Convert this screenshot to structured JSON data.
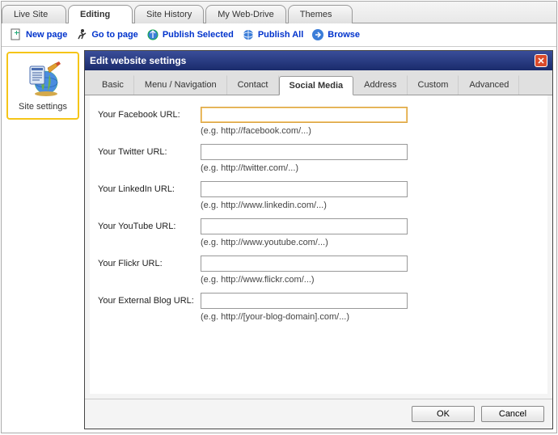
{
  "top_tabs": [
    "Live Site",
    "Editing",
    "Site History",
    "My Web-Drive",
    "Themes"
  ],
  "top_tabs_active": 1,
  "toolbar": {
    "new_page": "New page",
    "go_to_page": "Go to page",
    "publish_selected": "Publish Selected",
    "publish_all": "Publish All",
    "browse": "Browse"
  },
  "sidebar": {
    "site_settings": "Site settings"
  },
  "dialog": {
    "title": "Edit website settings",
    "tabs": [
      "Basic",
      "Menu / Navigation",
      "Contact",
      "Social Media",
      "Address",
      "Custom",
      "Advanced"
    ],
    "tabs_active": 3,
    "fields": [
      {
        "label": "Your Facebook URL:",
        "value": "",
        "hint": "(e.g. http://facebook.com/...)",
        "focused": true
      },
      {
        "label": "Your Twitter URL:",
        "value": "",
        "hint": "(e.g. http://twitter.com/...)"
      },
      {
        "label": "Your LinkedIn URL:",
        "value": "",
        "hint": "(e.g. http://www.linkedin.com/...)"
      },
      {
        "label": "Your YouTube URL:",
        "value": "",
        "hint": "(e.g. http://www.youtube.com/...)"
      },
      {
        "label": "Your Flickr URL:",
        "value": "",
        "hint": "(e.g. http://www.flickr.com/...)"
      },
      {
        "label": "Your External Blog URL:",
        "value": "",
        "hint": "(e.g. http://[your-blog-domain].com/...)"
      }
    ],
    "ok": "OK",
    "cancel": "Cancel"
  }
}
